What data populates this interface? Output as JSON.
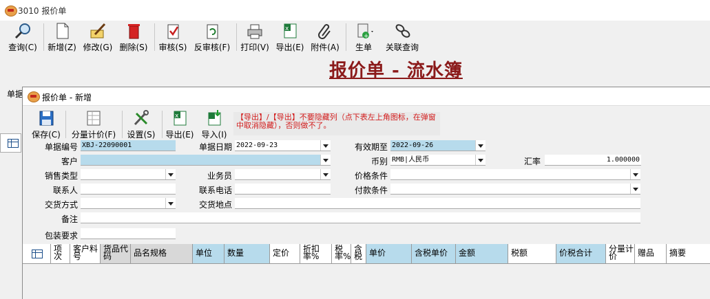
{
  "window": {
    "title": "3010 报价单"
  },
  "toolbar": [
    {
      "label": "查询(C)",
      "icon": "magnifier-icon",
      "name": "query-button"
    },
    {
      "label": "新增(Z)",
      "icon": "new-document-icon",
      "name": "new-button"
    },
    {
      "label": "修改(G)",
      "icon": "edit-icon",
      "name": "edit-button"
    },
    {
      "label": "删除(S)",
      "icon": "trash-icon",
      "name": "delete-button"
    },
    {
      "label": "审核(S)",
      "icon": "approve-icon",
      "name": "approve-button"
    },
    {
      "label": "反审核(F)",
      "icon": "unapprove-icon",
      "name": "unapprove-button"
    },
    {
      "label": "打印(V)",
      "icon": "printer-icon",
      "name": "print-button"
    },
    {
      "label": "导出(E)",
      "icon": "excel-export-icon",
      "name": "export-button"
    },
    {
      "label": "附件(A)",
      "icon": "paperclip-icon",
      "name": "attachment-button"
    },
    {
      "label": "生单",
      "icon": "generate-document-icon",
      "name": "generate-button"
    },
    {
      "label": "关联查询",
      "icon": "link-icon",
      "name": "related-query-button"
    }
  ],
  "main": {
    "title": "报价单 - 流水簿",
    "side_label": "单据"
  },
  "dialog": {
    "title": "报价单 - 新增",
    "toolbar": [
      {
        "label": "保存(C)",
        "icon": "save-icon",
        "name": "save-button"
      },
      {
        "label": "分量计价(F)",
        "icon": "pricing-icon",
        "name": "quantity-pricing-button"
      },
      {
        "label": "设置(S)",
        "icon": "settings-tools-icon",
        "name": "settings-button"
      },
      {
        "label": "导出(E)",
        "icon": "excel-export-icon",
        "name": "dialog-export-button"
      },
      {
        "label": "导入(I)",
        "icon": "excel-import-icon",
        "name": "dialog-import-button"
      }
    ],
    "warning": "【导出】/【导出】不要隐藏列（点下表左上角图标，在弹窗中取消隐藏），否则做不了。",
    "form": {
      "doc_no_label": "单据编号",
      "doc_no": "XBJ-22090001",
      "doc_date_label": "单据日期",
      "doc_date": "2022-09-23",
      "valid_until_label": "有效期至",
      "valid_until": "2022-09-26",
      "customer_label": "客户",
      "customer": "",
      "currency_label": "币别",
      "currency": "RMB|人民币",
      "rate_label": "汇率",
      "rate": "1.000000",
      "sales_type_label": "销售类型",
      "sales_type": "",
      "salesman_label": "业务员",
      "salesman": "",
      "price_terms_label": "价格条件",
      "price_terms": "",
      "contact_label": "联系人",
      "contact": "",
      "phone_label": "联系电话",
      "phone": "",
      "payment_terms_label": "付款条件",
      "payment_terms": "",
      "delivery_method_label": "交货方式",
      "delivery_method": "",
      "delivery_place_label": "交货地点",
      "delivery_place": "",
      "remark_label": "备注",
      "remark": "",
      "packing_label": "包装要求",
      "packing": ""
    },
    "grid": {
      "columns": [
        "项次",
        "客户料号",
        "货品代码",
        "品名规格",
        "单位",
        "数量",
        "定价",
        "折扣率%",
        "税率%",
        "含税",
        "单价",
        "含税单价",
        "金额",
        "税额",
        "价税合计",
        "分量计价",
        "赠品",
        "摘要"
      ]
    }
  },
  "colors": {
    "title_red": "#8b1a1a",
    "warning_red": "#d21b1b",
    "field_blue": "#b7dbec"
  }
}
